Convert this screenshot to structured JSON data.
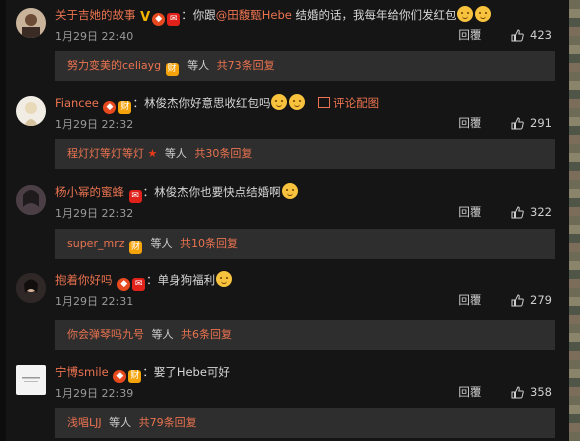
{
  "comments": [
    {
      "username": "关于吉她的故事",
      "text": "：你跟",
      "mention": "@田馥甄Hebe",
      "text2": " 结婚的话，我每年给你们发红包",
      "time": "1月29日 22:40",
      "reply_label": "回覆",
      "likes": "423",
      "sub_user": "努力变美的celiayg",
      "sub_mid": "等人",
      "sub_count": "共73条回复"
    },
    {
      "username": "Fiancee",
      "text": "：林俊杰你好意思收红包吗",
      "pic_link": "评论配图",
      "time": "1月29日 22:32",
      "reply_label": "回覆",
      "likes": "291",
      "sub_user": "程灯灯等灯等灯",
      "sub_mid": "等人",
      "sub_count": "共30条回复"
    },
    {
      "username": "杨小幂的蜜蜂",
      "text": "：林俊杰你也要快点结婚啊",
      "time": "1月29日 22:32",
      "reply_label": "回覆",
      "likes": "322",
      "sub_user": "super_mrz",
      "sub_mid": "等人",
      "sub_count": "共10条回复"
    },
    {
      "username": "抱着你好吗",
      "text": "：单身狗福利",
      "time": "1月29日 22:31",
      "reply_label": "回覆",
      "likes": "279",
      "sub_user": "你会弹琴吗九号",
      "sub_mid": "等人",
      "sub_count": "共6条回复"
    },
    {
      "username": "宁博smile",
      "text": "：娶了Hebe可好",
      "time": "1月29日 22:39",
      "reply_label": "回覆",
      "likes": "358",
      "sub_user": "浅唱LJJ",
      "sub_mid": "等人",
      "sub_count": "共79条回复"
    }
  ],
  "icons": {
    "like": "thumbs-up-icon",
    "pic": "image-icon"
  },
  "colors": {
    "background": "#151515",
    "username": "#eb7350",
    "subbox": "#2e2e2e",
    "text": "#d6d6d6",
    "meta": "#9a9a9a"
  }
}
